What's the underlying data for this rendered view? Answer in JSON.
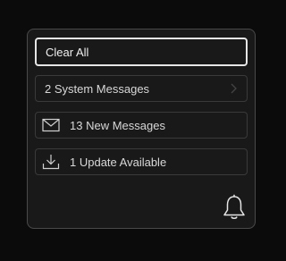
{
  "notifications": {
    "clear_all_label": "Clear All",
    "items": [
      {
        "label": "2 System Messages",
        "icon": "chevron-right-icon"
      },
      {
        "label": "13 New Messages",
        "icon": "envelope-icon"
      },
      {
        "label": "1 Update Available",
        "icon": "download-icon"
      }
    ],
    "bell_icon": "bell-icon"
  },
  "colors": {
    "background": "#0b0b0b",
    "panel": "#191919",
    "border": "#3a3a3a",
    "focus_border": "#e6e6e6",
    "text": "#d8d8d8"
  }
}
